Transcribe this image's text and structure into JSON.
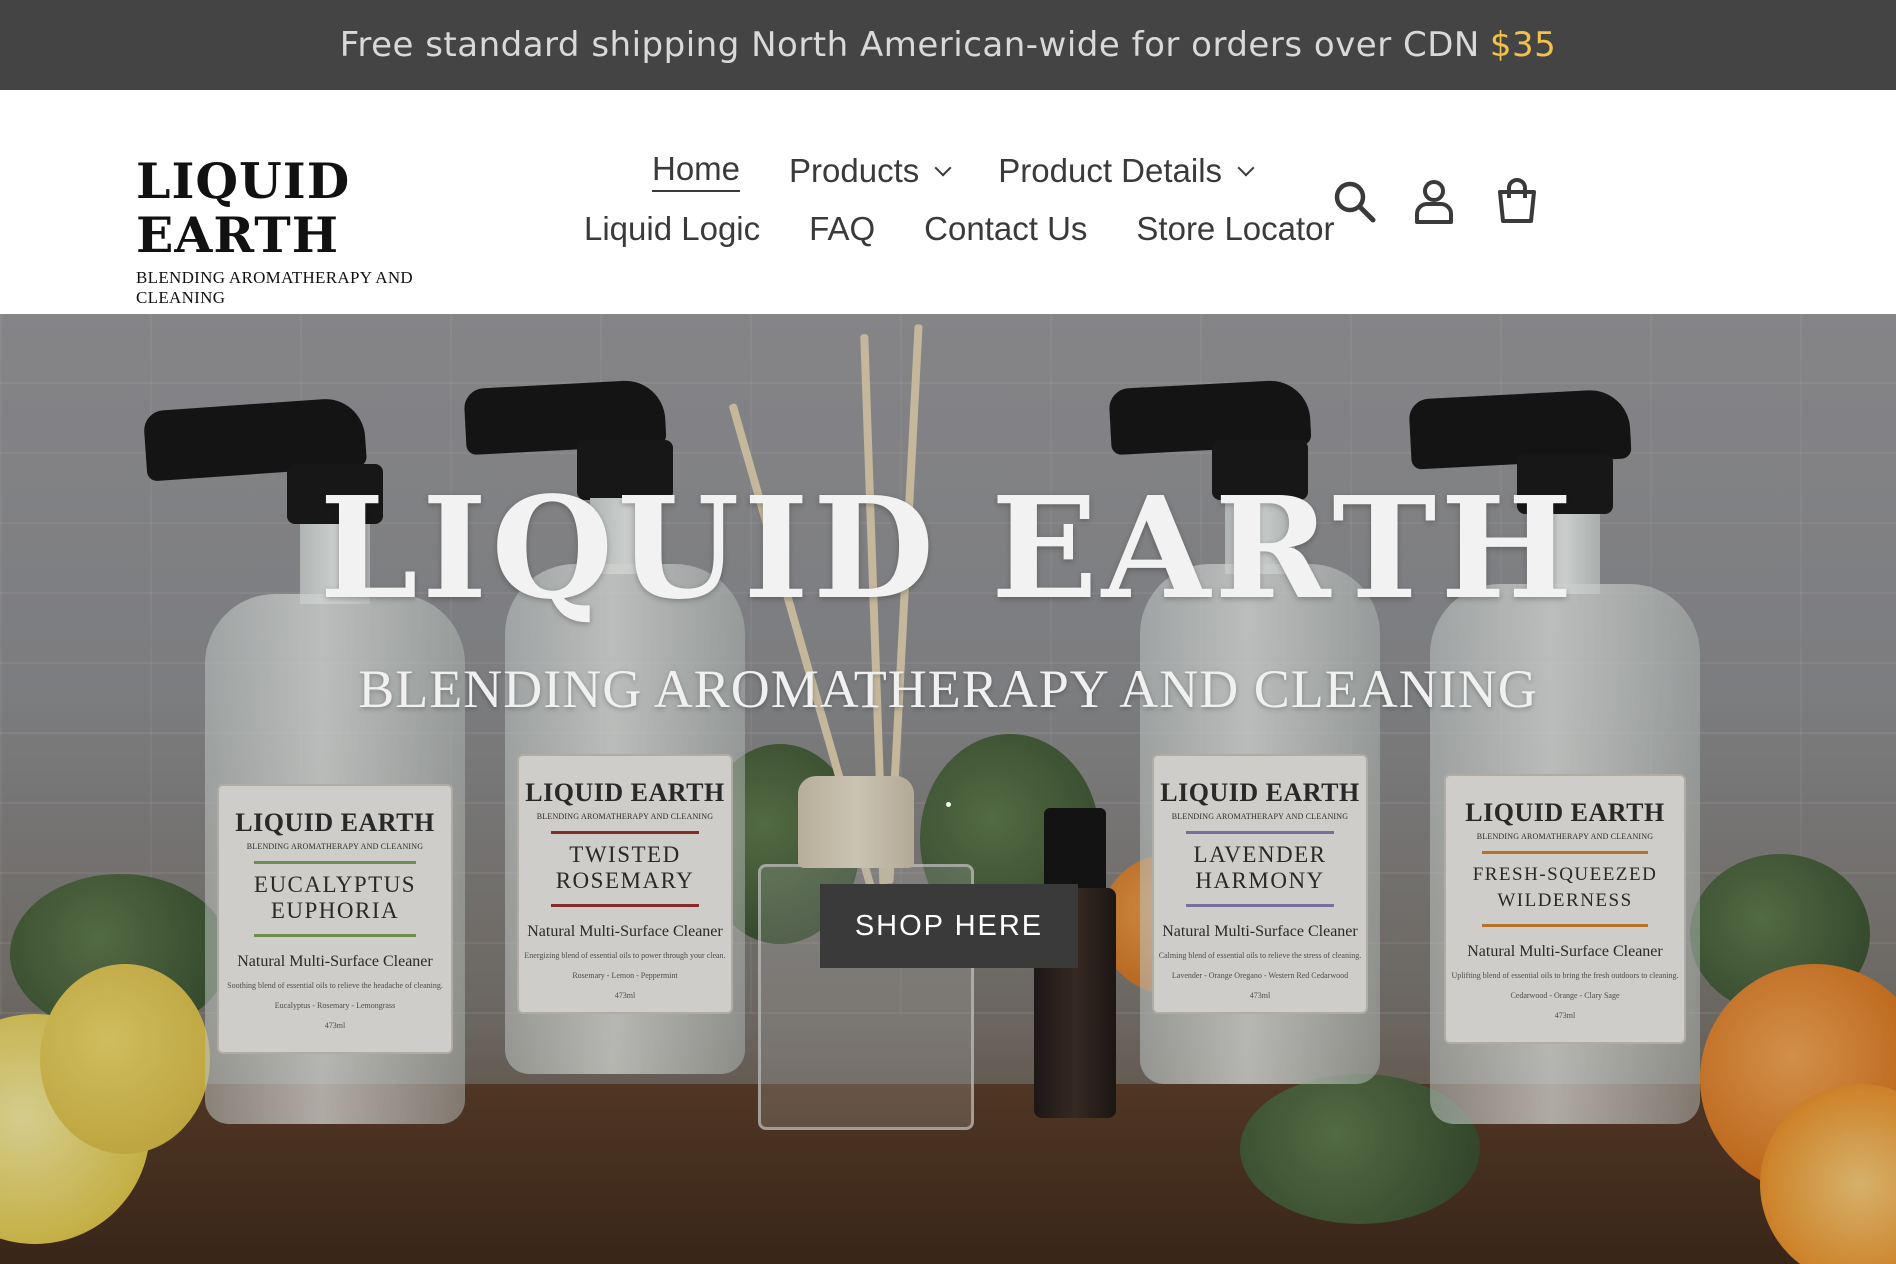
{
  "announcement": {
    "text": "Free standard shipping North American-wide for orders over CDN",
    "price": "$35"
  },
  "header": {
    "logo_title": "LIQUID EARTH",
    "logo_subtitle": "BLENDING AROMATHERAPY AND CLEANING",
    "nav": [
      {
        "label": "Home",
        "active": true,
        "dropdown": false
      },
      {
        "label": "Products",
        "active": false,
        "dropdown": true
      },
      {
        "label": "Product Details",
        "active": false,
        "dropdown": true
      },
      {
        "label": "Liquid Logic",
        "active": false,
        "dropdown": false
      },
      {
        "label": "FAQ",
        "active": false,
        "dropdown": false
      },
      {
        "label": "Contact Us",
        "active": false,
        "dropdown": false
      },
      {
        "label": "Store Locator",
        "active": false,
        "dropdown": false
      }
    ],
    "icons": [
      "search-icon",
      "account-icon",
      "cart-icon"
    ]
  },
  "hero": {
    "title": "LIQUID EARTH",
    "subtitle": "BLENDING AROMATHERAPY AND CLEANING",
    "cta": "SHOP HERE",
    "bottles": [
      {
        "brand": "LIQUID EARTH",
        "brand_sub": "BLENDING AROMATHERAPY AND CLEANING",
        "name_line1": "Eucalyptus",
        "name_line2": "Euphoria",
        "type": "Natural Multi-Surface Cleaner",
        "desc": "Soothing blend of essential oils to relieve the headache of cleaning.",
        "ingredients": "Eucalyptus - Rosemary - Lemongrass",
        "volume": "473ml",
        "accent": "#7aa657"
      },
      {
        "brand": "LIQUID EARTH",
        "brand_sub": "BLENDING AROMATHERAPY AND CLEANING",
        "name_line1": "Twisted",
        "name_line2": "Rosemary",
        "type": "Natural Multi-Surface Cleaner",
        "desc": "Energizing blend of essential oils to power through your clean.",
        "ingredients": "Rosemary - Lemon - Peppermint",
        "volume": "473ml",
        "accent": "#9b2d2d"
      },
      {
        "brand": "LIQUID EARTH",
        "brand_sub": "BLENDING AROMATHERAPY AND CLEANING",
        "name_line1": "Lavender",
        "name_line2": "Harmony",
        "type": "Natural Multi-Surface Cleaner",
        "desc": "Calming blend of essential oils to relieve the stress of cleaning.",
        "ingredients": "Lavender - Orange Oregano - Western Red Cedarwood",
        "volume": "473ml",
        "accent": "#8a7fb8"
      },
      {
        "brand": "LIQUID EARTH",
        "brand_sub": "BLENDING AROMATHERAPY AND CLEANING",
        "name_line1": "Fresh-Squeezed",
        "name_line2": "Wilderness",
        "type": "Natural Multi-Surface Cleaner",
        "desc": "Uplifting blend of essential oils to bring the fresh outdoors to cleaning.",
        "ingredients": "Cedarwood - Orange - Clary Sage",
        "volume": "473ml",
        "accent": "#d9822b"
      }
    ]
  },
  "colors": {
    "announcement_bg": "#444444",
    "price_accent": "#f0c14b",
    "button_bg": "#3a3a3a"
  }
}
